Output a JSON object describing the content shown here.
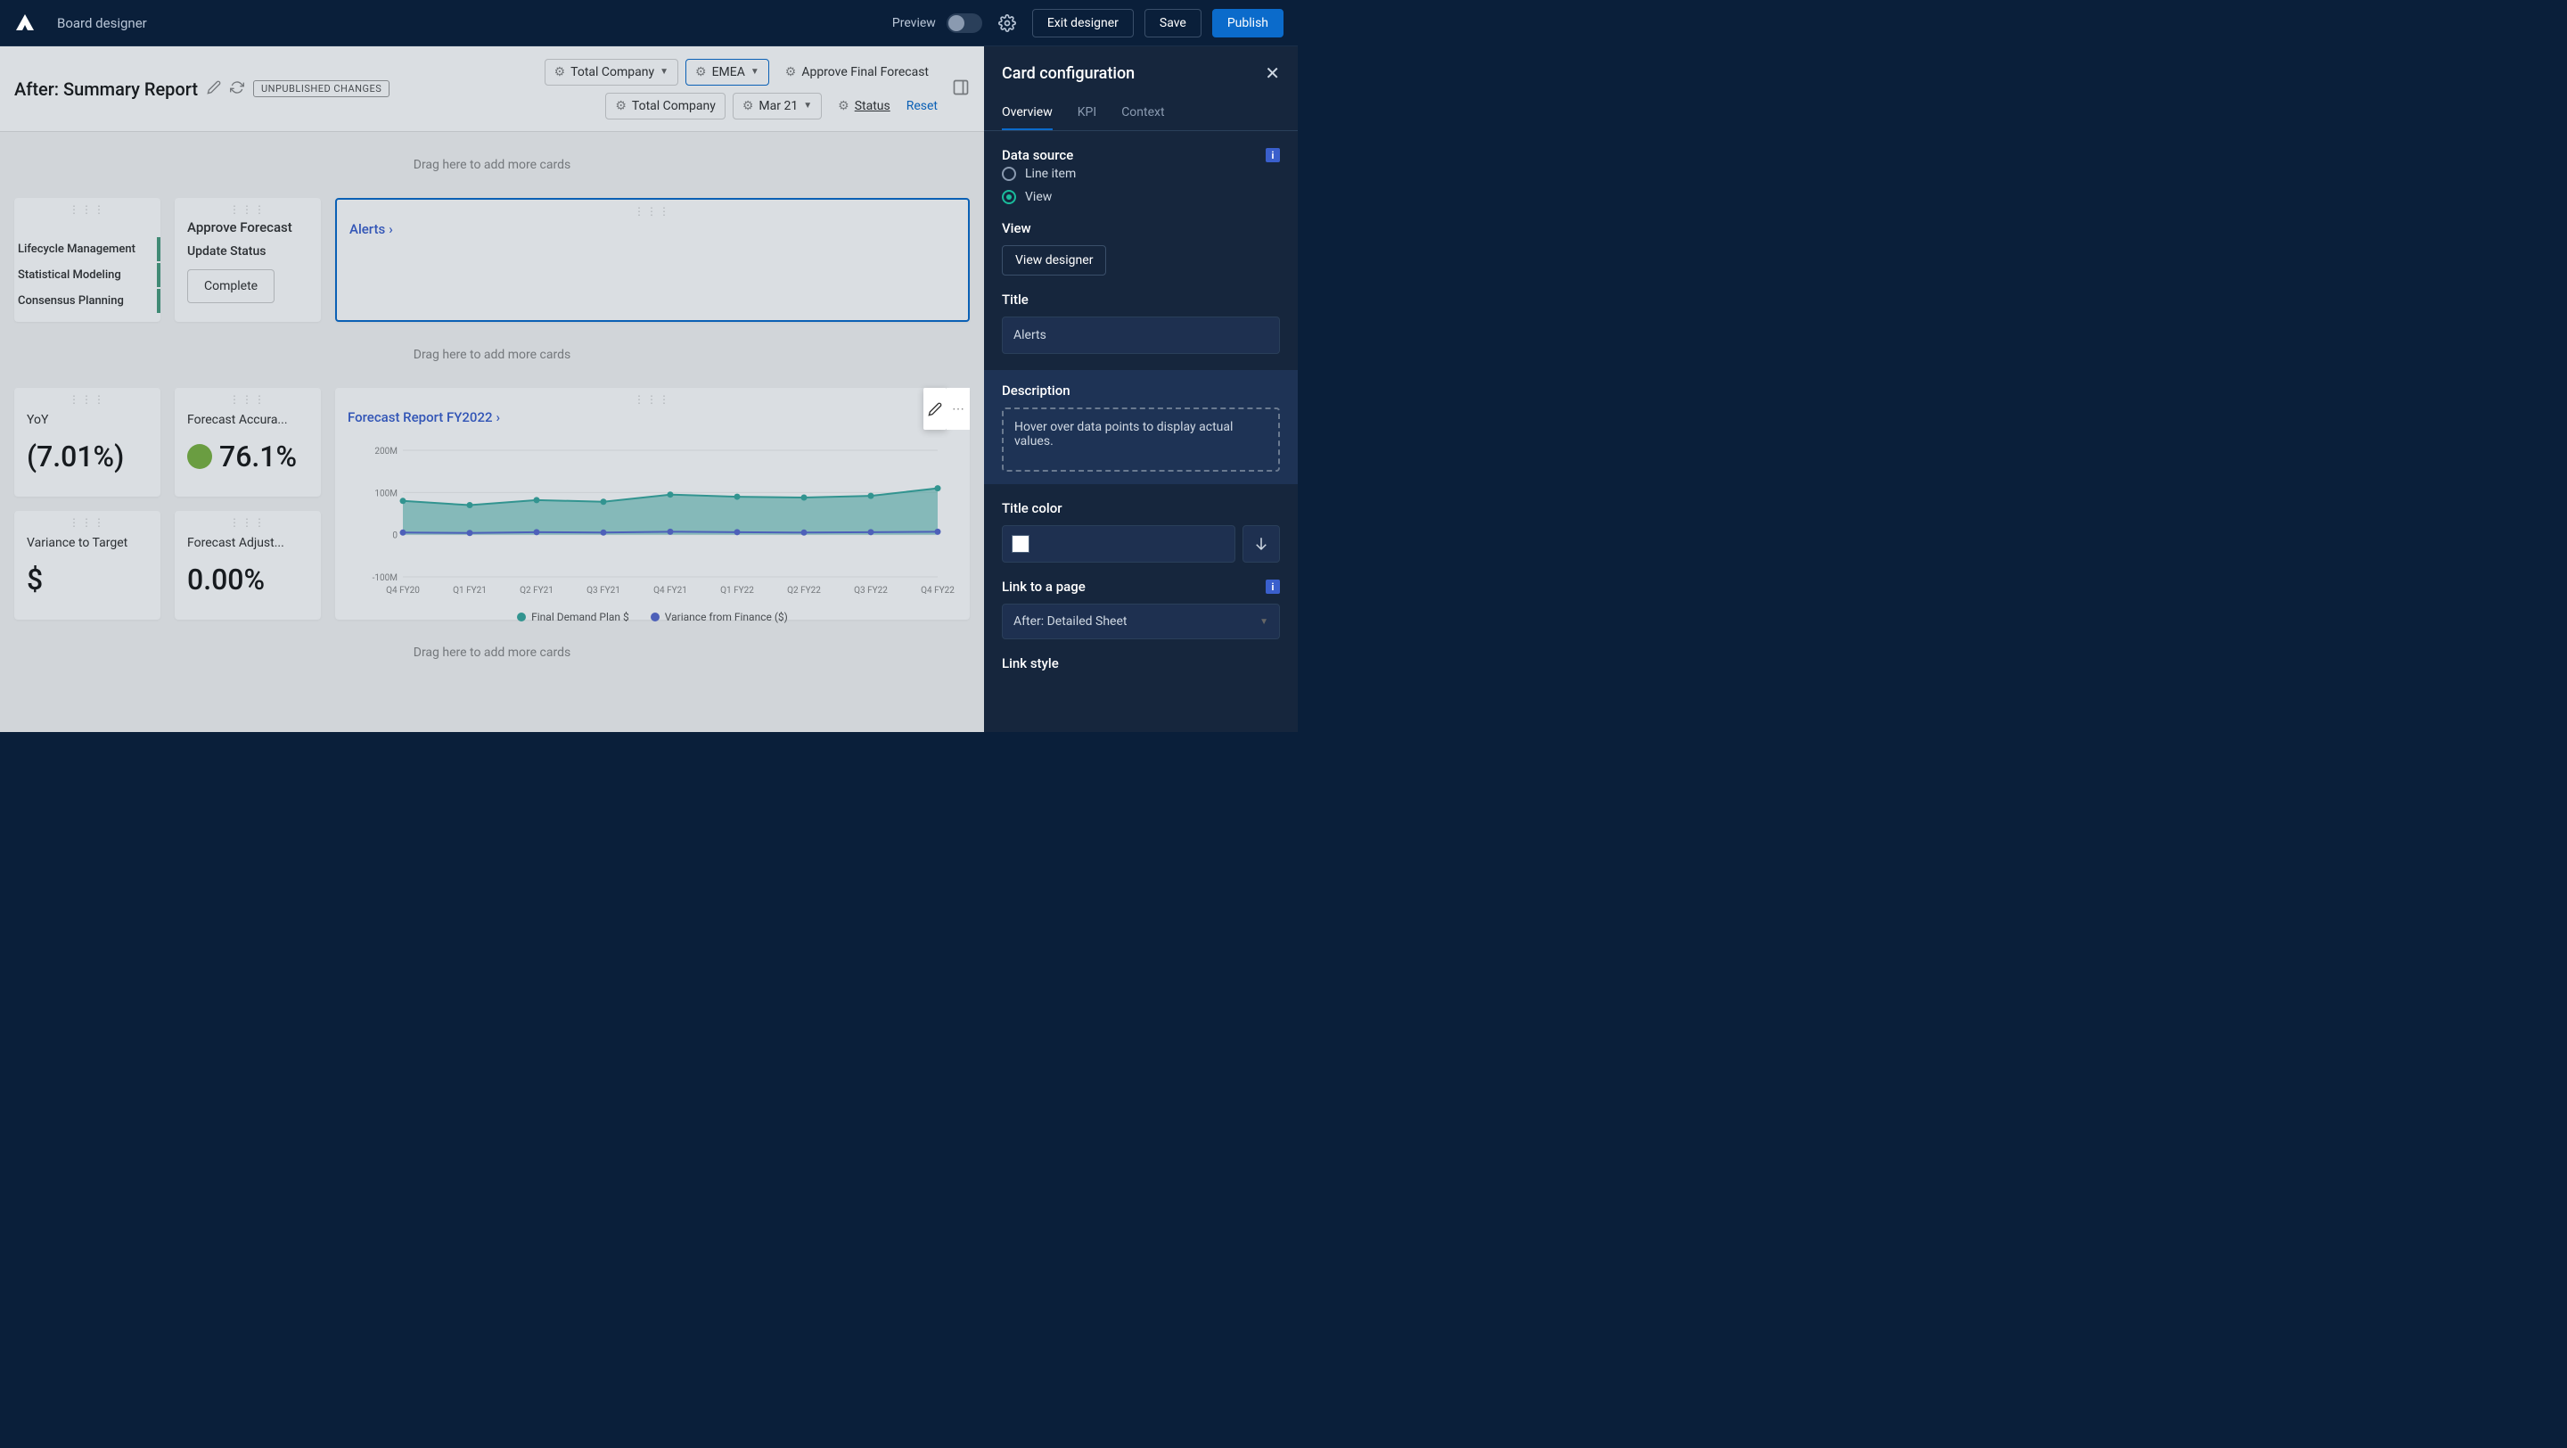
{
  "topbar": {
    "title": "Board designer",
    "preview": "Preview",
    "exit": "Exit designer",
    "save": "Save",
    "publish": "Publish"
  },
  "canvas": {
    "title": "After: Summary Report",
    "badge": "UNPUBLISHED CHANGES",
    "filters_row1": [
      "Total Company",
      "EMEA",
      "Approve Final Forecast"
    ],
    "filters_row2": [
      "Total Company",
      "Mar 21",
      "Status"
    ],
    "reset": "Reset",
    "dropzone": "Drag here to add more cards"
  },
  "cards": {
    "nav": [
      "Lifecycle Management",
      "Statistical Modeling",
      "Consensus Planning"
    ],
    "approve": {
      "title": "Approve Forecast",
      "label": "Update Status",
      "button": "Complete"
    },
    "alerts": {
      "title": "Alerts"
    },
    "yoy": {
      "label": "YoY",
      "value": "(7.01%)"
    },
    "accuracy": {
      "label": "Forecast Accura...",
      "value": "76.1%"
    },
    "variance": {
      "label": "Variance to Target",
      "value": "$"
    },
    "adjustment": {
      "label": "Forecast Adjust...",
      "value": "0.00%"
    },
    "report": {
      "title": "Forecast Report FY2022"
    }
  },
  "panel": {
    "title": "Card configuration",
    "tabs": [
      "Overview",
      "KPI",
      "Context"
    ],
    "data_source": "Data source",
    "radio_line": "Line item",
    "radio_view": "View",
    "view_label": "View",
    "view_designer": "View designer",
    "title_label": "Title",
    "title_value": "Alerts",
    "description_label": "Description",
    "description_value": "Hover over data points to display actual values.",
    "title_color": "Title color",
    "link_page": "Link to a page",
    "link_value": "After: Detailed Sheet",
    "link_style": "Link style"
  },
  "chart_data": {
    "type": "area",
    "title": "Forecast Report FY2022",
    "ylabel": "",
    "xlabel": "",
    "yticks": [
      "-100M",
      "0",
      "100M",
      "200M"
    ],
    "ylim": [
      -100,
      200
    ],
    "categories": [
      "Q4 FY20",
      "Q1 FY21",
      "Q2 FY21",
      "Q3 FY21",
      "Q4 FY21",
      "Q1 FY22",
      "Q2 FY22",
      "Q3 FY22",
      "Q4 FY22"
    ],
    "series": [
      {
        "name": "Final Demand Plan $",
        "color": "#3aa99f",
        "values": [
          80,
          70,
          82,
          78,
          95,
          90,
          88,
          92,
          110
        ]
      },
      {
        "name": "Variance from Finance ($)",
        "color": "#5a6bcf",
        "values": [
          5,
          4,
          6,
          5,
          7,
          6,
          5,
          6,
          7
        ]
      }
    ],
    "legend": [
      "Final Demand Plan $",
      "Variance from Finance ($)"
    ]
  }
}
